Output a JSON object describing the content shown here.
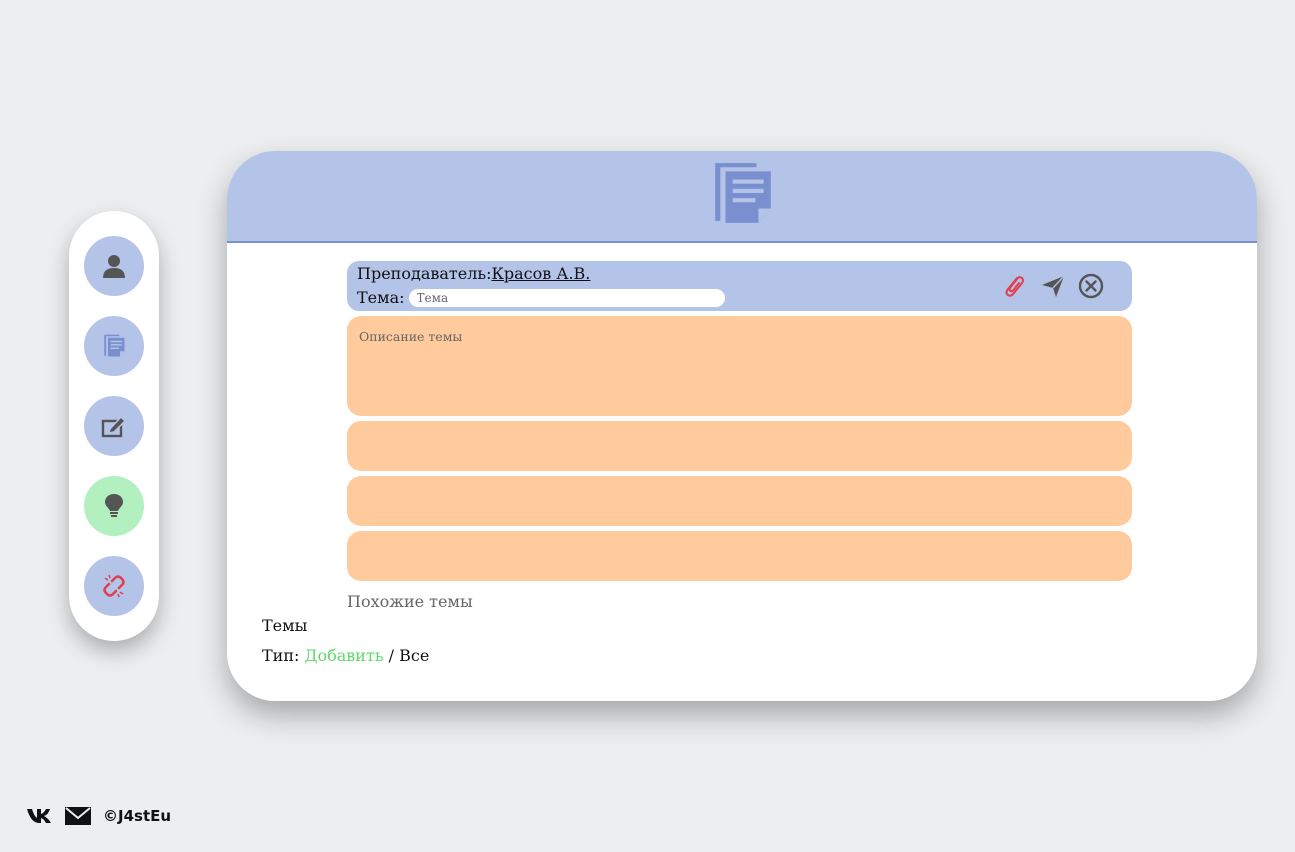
{
  "sidebar": {
    "items": [
      {
        "icon": "user-icon",
        "color": "#b4c3e8"
      },
      {
        "icon": "documents-icon",
        "color": "#b4c3e8"
      },
      {
        "icon": "edit-icon",
        "color": "#b4c3e8"
      },
      {
        "icon": "lightbulb-icon",
        "color": "#b2f0bf"
      },
      {
        "icon": "broken-link-icon",
        "color": "#b4c3e8"
      }
    ]
  },
  "header": {
    "logo_icon": "documents-icon"
  },
  "form": {
    "teacher_label": "Преподаватель:",
    "teacher_name": "Красов А.В.",
    "topic_label": "Тема:",
    "topic_placeholder": "Тема",
    "topic_value": "",
    "description_placeholder": "Описание темы",
    "actions": [
      "paperclip-icon",
      "send-icon",
      "close-circle-icon"
    ]
  },
  "similar_label": "Похожие темы",
  "themes_label": "Темы",
  "type_line": {
    "label": "Тип:",
    "add": "Добавить",
    "separator": "/",
    "all": "Все"
  },
  "footer": {
    "icons": [
      "vk-icon",
      "mail-icon"
    ],
    "copyright": "©J4stEu"
  },
  "colors": {
    "accent": "#b4c3e8",
    "accent_dark": "#7a8fd0",
    "orange": "#ffca9c",
    "green": "#b2f0bf",
    "link_green": "#5fd86b",
    "danger": "#e0414d",
    "background": "#edeef0"
  }
}
